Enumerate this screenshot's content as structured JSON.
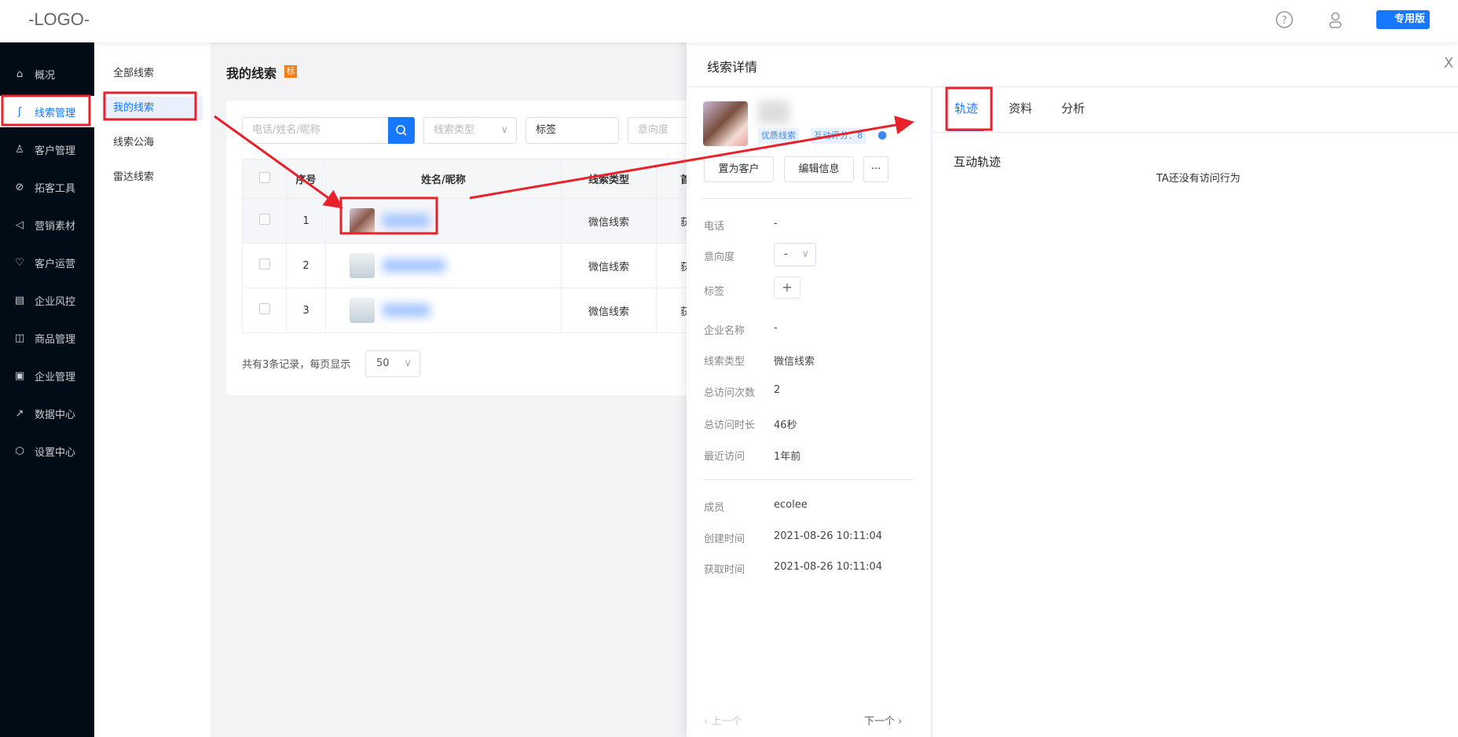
{
  "header": {
    "logo": "-LOGO-",
    "badge": "专用版"
  },
  "sidebar": {
    "items": [
      {
        "label": "概况",
        "icon": "home-icon"
      },
      {
        "label": "线索管理",
        "icon": "clue-icon",
        "active": true
      },
      {
        "label": "客户管理",
        "icon": "customer-icon"
      },
      {
        "label": "拓客工具",
        "icon": "handshake-icon"
      },
      {
        "label": "营销素材",
        "icon": "megaphone-icon"
      },
      {
        "label": "客户运营",
        "icon": "operation-icon"
      },
      {
        "label": "企业风控",
        "icon": "risk-icon"
      },
      {
        "label": "商品管理",
        "icon": "bag-icon"
      },
      {
        "label": "企业管理",
        "icon": "briefcase-icon"
      },
      {
        "label": "数据中心",
        "icon": "chart-icon"
      },
      {
        "label": "设置中心",
        "icon": "settings-icon"
      }
    ]
  },
  "submenu": {
    "items": [
      "全部线索",
      "我的线索",
      "线索公海",
      "雷达线索"
    ],
    "active": 1
  },
  "main": {
    "title": "我的线索",
    "title_badge": "标",
    "filters": {
      "search_placeholder": "电话/姓名/昵称",
      "type_placeholder": "线索类型",
      "tag_value": "标签",
      "intent_placeholder": "意向度"
    },
    "table": {
      "headers": [
        "序号",
        "姓名/昵称",
        "线索类型",
        "首"
      ],
      "rows": [
        {
          "index": "1",
          "type": "微信线索",
          "col4": "获"
        },
        {
          "index": "2",
          "type": "微信线索",
          "col4": "获"
        },
        {
          "index": "3",
          "type": "微信线索",
          "col4": "获"
        }
      ]
    },
    "pager": {
      "text": "共有3条记录，每页显示",
      "size": "50"
    }
  },
  "drawer": {
    "title": "线索详情",
    "close": "X",
    "tags": [
      "优质线索",
      "互动评分：8"
    ],
    "buttons": {
      "to_customer": "置为客户",
      "edit": "编辑信息",
      "more": "···"
    },
    "fields": [
      {
        "label": "电话",
        "value": "-"
      },
      {
        "label": "意向度",
        "value": "-"
      },
      {
        "label": "标签",
        "value": "+"
      },
      {
        "label": "企业名称",
        "value": "-"
      },
      {
        "label": "线索类型",
        "value": "微信线索"
      },
      {
        "label": "总访问次数",
        "value": "2"
      },
      {
        "label": "总访问时长",
        "value": "46秒"
      },
      {
        "label": "最近访问",
        "value": "1年前"
      },
      {
        "label": "成员",
        "value": "ecolee"
      },
      {
        "label": "创建时间",
        "value": "2021-08-26 10:11:04"
      },
      {
        "label": "获取时间",
        "value": "2021-08-26 10:11:04"
      }
    ],
    "prev": "‹ 上一个",
    "next": "下一个 ›",
    "tabs": [
      "轨迹",
      "资料",
      "分析"
    ],
    "section_title": "互动轨迹",
    "empty_text": "TA还没有访问行为"
  },
  "colors": {
    "accent": "#1677ff",
    "sidebar": "#020c17",
    "annotation": "#e8212b"
  }
}
